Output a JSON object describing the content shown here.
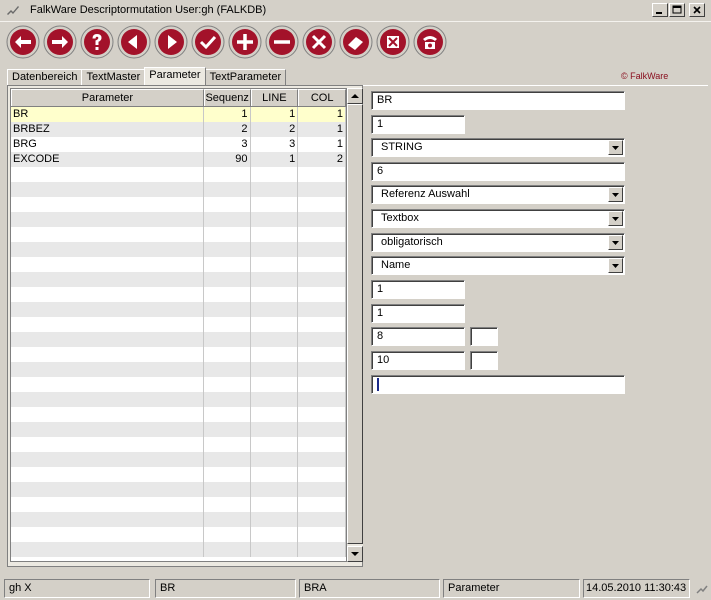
{
  "window": {
    "title": "FalkWare Descriptormutation User:gh    (FALKDB)",
    "controls": [
      "minimize-icon",
      "maximize-icon",
      "close-icon"
    ]
  },
  "toolbar": {
    "buttons": [
      {
        "icon": "arrow-left-icon"
      },
      {
        "icon": "arrow-right-icon"
      },
      {
        "icon": "help-icon"
      },
      {
        "icon": "previous-icon"
      },
      {
        "icon": "next-icon"
      },
      {
        "icon": "check-icon"
      },
      {
        "icon": "plus-icon"
      },
      {
        "icon": "minus-icon"
      },
      {
        "icon": "cancel-icon"
      },
      {
        "icon": "eraser-icon"
      },
      {
        "icon": "excel-icon"
      },
      {
        "icon": "phone-icon"
      }
    ],
    "accent": "#a3122a"
  },
  "tabs": [
    "Datenbereich",
    "TextMaster",
    "Parameter",
    "TextParameter"
  ],
  "active_tab": "Parameter",
  "brand": "© FalkWare",
  "grid": {
    "columns": [
      "Parameter",
      "Sequenz",
      "LINE",
      "COL"
    ],
    "rows": [
      [
        "BR",
        "1",
        "1",
        "1"
      ],
      [
        "BRBEZ",
        "2",
        "2",
        "1"
      ],
      [
        "BRG",
        "3",
        "3",
        "1"
      ],
      [
        "EXCODE",
        "90",
        "1",
        "2"
      ]
    ],
    "selected_row": 0
  },
  "form": {
    "name": "BR",
    "seq": "1",
    "type": "STRING",
    "length": "6",
    "reference": "Referenz Auswahl",
    "control": "Textbox",
    "required": "obligatorisch",
    "source": "Name",
    "line": "1",
    "col": "1",
    "width_a": "8",
    "width_b": "",
    "height_a": "10",
    "height_b": "",
    "extra": ""
  },
  "status": {
    "user": "gh  X",
    "field1": "BR",
    "field2": "BRA",
    "field3": "Parameter",
    "datetime": "14.05.2010 11:30:43"
  }
}
